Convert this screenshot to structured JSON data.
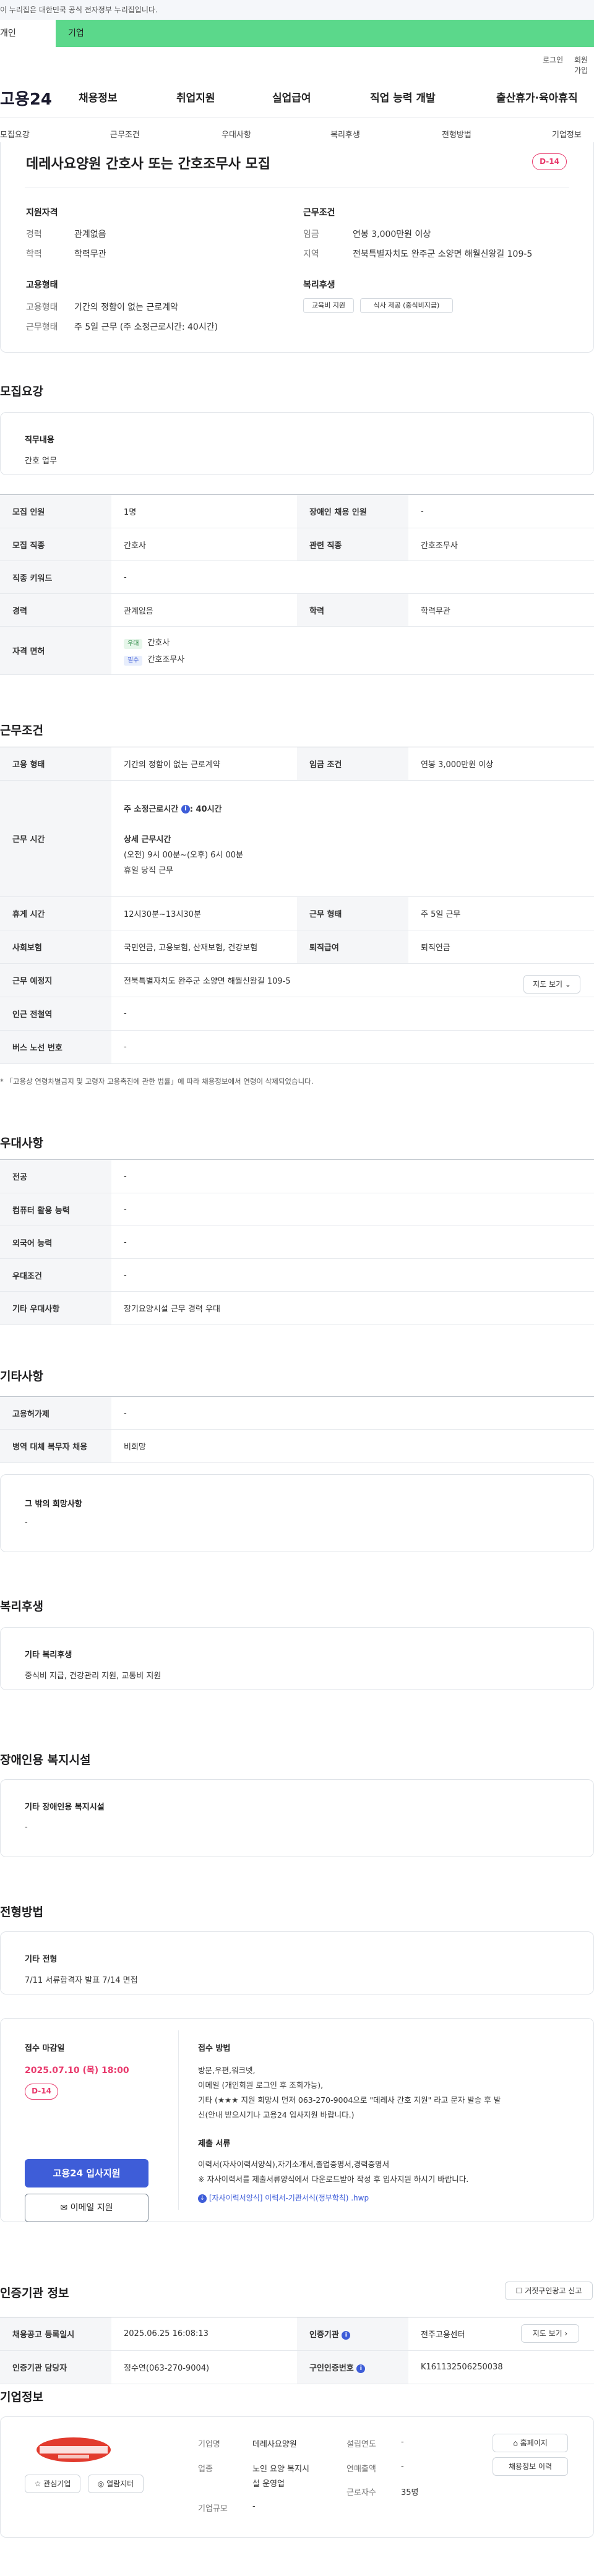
{
  "gov_banner": "이 누리집은 대한민국 공식 전자정부 누리집입니다.",
  "tabs": {
    "personal": "개인",
    "company": "기업"
  },
  "util": {
    "login": "로그인",
    "signup": "회원가입"
  },
  "logo": "고용24",
  "gnb": [
    "채용정보",
    "취업지원",
    "실업급여",
    "직업 능력 개발",
    "출산휴가·육아휴직"
  ],
  "lnb": [
    "모집요강",
    "근무조건",
    "우대사항",
    "복리후생",
    "전형방법",
    "기업정보"
  ],
  "summary": {
    "title": "데레사요양원 간호사 또는 간호조무사 모집",
    "dday": "D-14",
    "qual_heading": "지원자격",
    "career_label": "경력",
    "career_value": "관계없음",
    "edu_label": "학력",
    "edu_value": "학력무관",
    "cond_heading": "근무조건",
    "wage_label": "임금",
    "wage_value": "연봉 3,000만원 이상",
    "region_label": "지역",
    "region_value": "전북특별자치도 완주군 소양면 해월신왕길 109-5",
    "emp_heading": "고용형태",
    "emptype_label": "고용형태",
    "emptype_value": "기간의 정함이 없는 근로계약",
    "worktype_label": "근무형태",
    "worktype_value": "주 5일 근무 (주 소정근로시간: 40시간)",
    "welfare_heading": "복리후생",
    "welfare_chips": [
      "교육비 지원",
      "식사 제공 (중식비지급)"
    ]
  },
  "recruit": {
    "heading": "모집요강",
    "duty_label": "직무내용",
    "duty_value": "간호 업무",
    "rows": {
      "headcount_label": "모집 인원",
      "headcount": "1명",
      "disabled_label": "장애인 채용 인원",
      "disabled": "-",
      "job_label": "모집 직종",
      "job": "간호사",
      "related_label": "관련 직종",
      "related": "간호조무사",
      "keyword_label": "직종 키워드",
      "keyword": "-",
      "career_label": "경력",
      "career": "관계없음",
      "edu_label": "학력",
      "edu": "학력무관",
      "license_label": "자격 면허",
      "license_pref_tag": "우대",
      "license_pref": "간호사",
      "license_req_tag": "필수",
      "license_req": "간호조무사"
    }
  },
  "conditions": {
    "heading": "근무조건",
    "emptype_label": "고용 형태",
    "emptype": "기간의 정함이 없는 근로계약",
    "wage_label": "임금 조건",
    "wage": "연봉 3,000만원 이상",
    "hours_label": "근무 시간",
    "hours_weekly": "주 소정근로시간",
    "hours_weekly_value": ": 40시간",
    "hours_detail_title": "상세 근무시간",
    "hours_detail": "(오전) 9시 00분~(오후) 6시 00분",
    "hours_extra": "휴일 당직 근무",
    "break_label": "휴게 시간",
    "break": "12시30분~13시30분",
    "worktype_label": "근무 형태",
    "worktype": "주 5일 근무",
    "insurance_label": "사회보험",
    "insurance": "국민연금, 고용보험, 산재보험, 건강보험",
    "severance_label": "퇴직급여",
    "severance": "퇴직연금",
    "place_label": "근무 예정지",
    "place": "전북특별자치도 완주군 소양면 해월신왕길 109-5",
    "map_btn": "지도 보기",
    "station_label": "인근 전철역",
    "station": "-",
    "bus_label": "버스 노선 번호",
    "bus": "-",
    "note": "* 「고용상 연령차별금지 및 고령자 고용촉진에 관한 법률」에 따라 채용정보에서 연령이 삭제되었습니다."
  },
  "preference": {
    "heading": "우대사항",
    "rows": [
      {
        "label": "전공",
        "value": "-"
      },
      {
        "label": "컴퓨터 활용 능력",
        "value": "-"
      },
      {
        "label": "외국어 능력",
        "value": "-"
      },
      {
        "label": "우대조건",
        "value": "-"
      },
      {
        "label": "기타 우대사항",
        "value": "장기요양시설 근무 경력 우대"
      }
    ]
  },
  "etc": {
    "heading": "기타사항",
    "rows": [
      {
        "label": "고용허가제",
        "value": "-"
      },
      {
        "label": "병역 대체 복무자 채용",
        "value": "비희망"
      }
    ],
    "box_label": "그 밖의 희망사항",
    "box_value": "-"
  },
  "welfare": {
    "heading": "복리후생",
    "box_label": "기타 복리후생",
    "box_value": "중식비 지급, 건강관리 지원, 교통비 지원"
  },
  "disabled_facility": {
    "heading": "장애인용 복지시설",
    "box_label": "기타 장애인용 복지시설",
    "box_value": "-"
  },
  "screening": {
    "heading": "전형방법",
    "box_label": "기타 전형",
    "box_value": "7/11 서류합격자 발표 7/14 면접",
    "deadline_label": "접수 마감일",
    "deadline": "2025.07.10 (목) 18:00",
    "dday": "D-14",
    "apply_btn": "고용24 입사지원",
    "email_btn": "이메일 지원",
    "method_label": "접수 방법",
    "method_lines": [
      "방문,우편,워크넷,",
      "이메일 (개인회원 로그인 후 조회가능),",
      "기타 (★★★ 지원 희망시 먼저 063-270-9004으로 \"데레사 간호 지원\" 라고 문자 발송 후 발",
      "신(안내 받으시기나 고용24 입사지원 바랍니다.)"
    ],
    "docs_label": "제출 서류",
    "docs_lines": [
      "이력서(자사이력서양식),자기소개서,졸업증명서,경력증명서",
      "※ 자사이력서를 제출서류양식에서 다운로드받아 작성 후 입사지원 하시기 바랍니다."
    ],
    "file_link": "[자사이력서양식] 이력서-기관서식(정부학칙) .hwp"
  },
  "agency": {
    "heading": "인증기관 정보",
    "report_btn": "거짓구인광고 신고",
    "regdate_label": "채용공고 등록일시",
    "regdate": "2025.06.25 16:08:13",
    "org_label": "인증기관",
    "org": "전주고용센터",
    "map_btn": "지도 보기",
    "manager_label": "인증기관 담당자",
    "manager": "정수연(063-270-9004)",
    "regno_label": "구인인증번호",
    "regno": "K161132506250038"
  },
  "company": {
    "heading": "기업정보",
    "interest_btn": "관심기업",
    "hidden_btn": "열람지터",
    "name_label": "기업명",
    "name": "데레사요양원",
    "industry_label": "업종",
    "industry_1": "노인 요양 복지시",
    "industry_2": "설 운영업",
    "scale_label": "기업규모",
    "scale": "-",
    "found_label": "설립연도",
    "found": "-",
    "sales_label": "연매출액",
    "sales": "-",
    "staff_label": "근로자수",
    "staff": "35명",
    "homepage_btn": "홈페이지",
    "jobs_btn": "채용정보 이력"
  }
}
